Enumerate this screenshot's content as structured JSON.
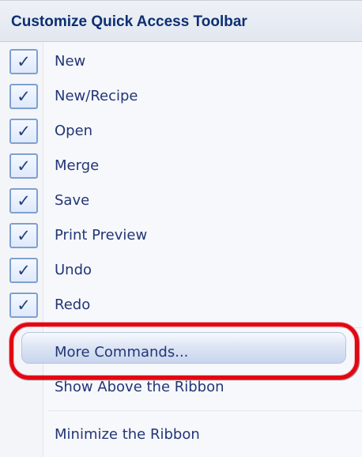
{
  "menu": {
    "title": "Customize Quick Access Toolbar",
    "checked_items": [
      {
        "label": "New",
        "checked": true
      },
      {
        "label": "New/Recipe",
        "checked": true
      },
      {
        "label": "Open",
        "checked": true
      },
      {
        "label": "Merge",
        "checked": true
      },
      {
        "label": "Save",
        "checked": true
      },
      {
        "label": "Print Preview",
        "checked": true
      },
      {
        "label": "Undo",
        "checked": true
      },
      {
        "label": "Redo",
        "checked": true
      }
    ],
    "more_commands": "More Commands...",
    "show_above_ribbon": "Show Above the Ribbon",
    "minimize_ribbon": "Minimize the Ribbon"
  },
  "icons": {
    "check": "check-icon"
  },
  "colors": {
    "text": "#223676",
    "header_text": "#0d2f73",
    "check_border": "#7ea0d1",
    "highlight": "#c7d5ec",
    "callout": "#e30613"
  }
}
